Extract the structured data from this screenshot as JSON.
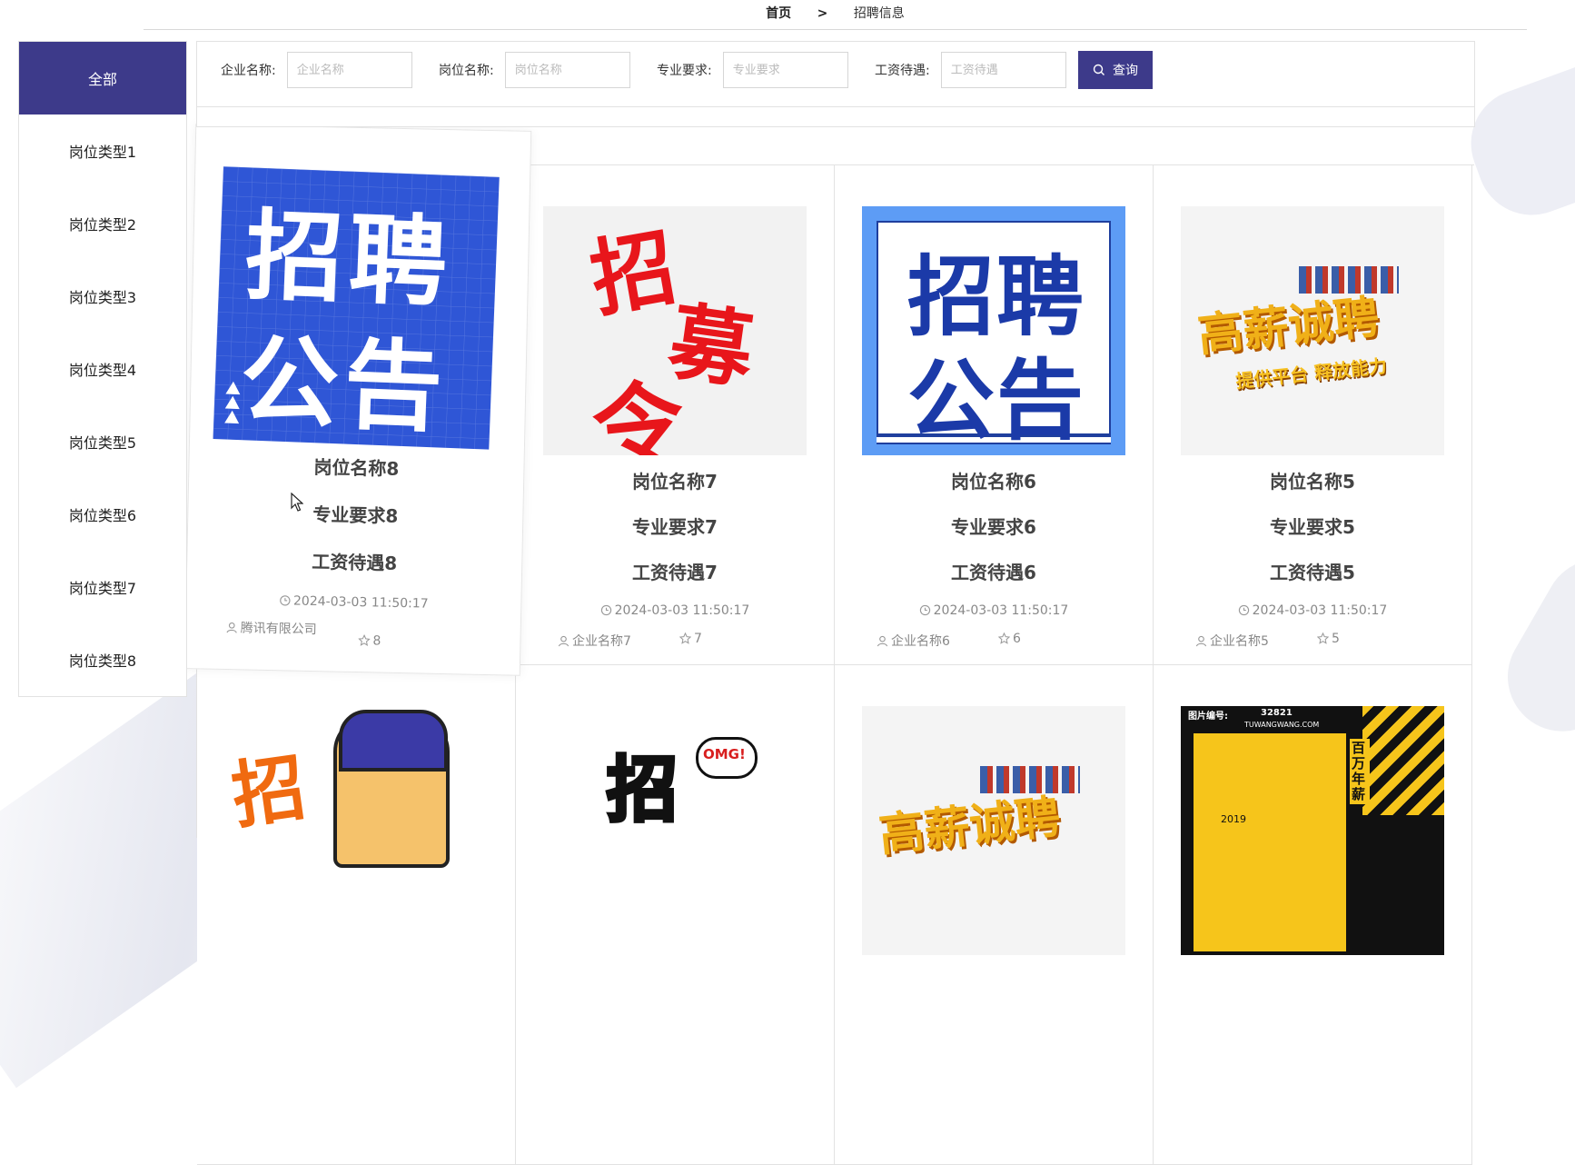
{
  "breadcrumb": {
    "home": "首页",
    "separator": ">",
    "current": "招聘信息"
  },
  "sidebar": {
    "active": "全部",
    "items": [
      "岗位类型1",
      "岗位类型2",
      "岗位类型3",
      "岗位类型4",
      "岗位类型5",
      "岗位类型6",
      "岗位类型7",
      "岗位类型8"
    ]
  },
  "search": {
    "company_label": "企业名称:",
    "company_placeholder": "企业名称",
    "position_label": "岗位名称:",
    "position_placeholder": "岗位名称",
    "major_label": "专业要求:",
    "major_placeholder": "专业要求",
    "salary_label": "工资待遇:",
    "salary_placeholder": "工资待遇",
    "button_label": "查询"
  },
  "colors": {
    "accent": "#3d3a8a"
  },
  "cards": [
    {
      "position": "岗位名称8",
      "major": "专业要求8",
      "salary": "工资待遇8",
      "time": "2024-03-03 11:50:17",
      "company": "腾讯有限公司",
      "likes": "8",
      "poster": {
        "line1": "招聘",
        "line2": "公告"
      }
    },
    {
      "position": "岗位名称7",
      "major": "专业要求7",
      "salary": "工资待遇7",
      "time": "2024-03-03 11:50:17",
      "company": "企业名称7",
      "likes": "7",
      "poster": {
        "line1": "招",
        "line2": "募",
        "line3": "令"
      }
    },
    {
      "position": "岗位名称6",
      "major": "专业要求6",
      "salary": "工资待遇6",
      "time": "2024-03-03 11:50:17",
      "company": "企业名称6",
      "likes": "6",
      "poster": {
        "line1": "招聘",
        "line2": "公告"
      }
    },
    {
      "position": "岗位名称5",
      "major": "专业要求5",
      "salary": "工资待遇5",
      "time": "2024-03-03 11:50:17",
      "company": "企业名称5",
      "likes": "5",
      "poster": {
        "line1": "高薪诚聘",
        "line2": "提供平台 释放能力"
      }
    }
  ],
  "bottom_posters": {
    "p1": "招",
    "p2a": "招",
    "p2b": "OMG!",
    "p3": "高薪诚聘",
    "p4a": "图片编号:",
    "p4b": "32821",
    "p4c": "TUWANGWANG.COM",
    "p4d": "百万年薪",
    "p4e": "2019"
  }
}
